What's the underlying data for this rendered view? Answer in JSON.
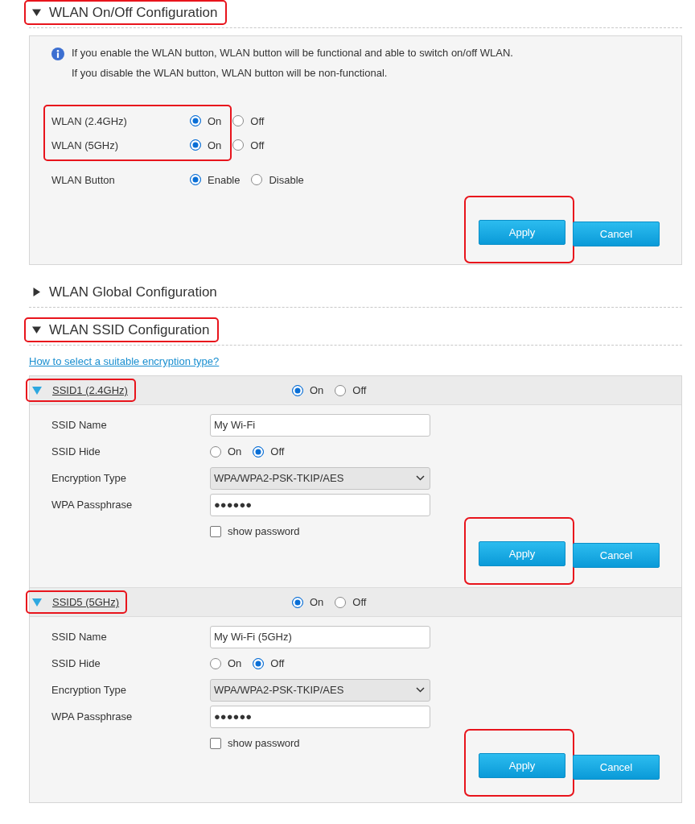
{
  "sections": [
    {
      "kind": "onoff",
      "title": "WLAN On/Off Configuration",
      "expanded": true,
      "highlighted": true,
      "info": [
        "If you enable the WLAN button, WLAN button will be functional and able to switch on/off WLAN.",
        "If you disable the WLAN button, WLAN button will be non-functional."
      ],
      "row_groups": [
        {
          "highlighted": true,
          "rows": [
            {
              "label": "WLAN (2.4GHz)",
              "options": [
                {
                  "label": "On",
                  "selected": true
                },
                {
                  "label": "Off",
                  "selected": false
                }
              ]
            },
            {
              "label": "WLAN (5GHz)",
              "options": [
                {
                  "label": "On",
                  "selected": true
                },
                {
                  "label": "Off",
                  "selected": false
                }
              ]
            }
          ]
        },
        {
          "highlighted": false,
          "rows": [
            {
              "label": "WLAN Button",
              "options": [
                {
                  "label": "Enable",
                  "selected": true
                },
                {
                  "label": "Disable",
                  "selected": false
                }
              ]
            }
          ]
        }
      ],
      "buttons": [
        {
          "label": "Apply",
          "highlighted": true
        },
        {
          "label": "Cancel",
          "highlighted": false
        }
      ]
    },
    {
      "kind": "collapsed",
      "title": "WLAN Global Configuration",
      "expanded": false,
      "highlighted": false
    },
    {
      "kind": "ssid",
      "title": "WLAN SSID Configuration",
      "expanded": true,
      "highlighted": true,
      "link": "How to select a suitable encryption type?",
      "ssids": [
        {
          "name": "SSID1 (2.4GHz)",
          "expanded": true,
          "highlighted": true,
          "options": [
            {
              "label": "On",
              "selected": true
            },
            {
              "label": "Off",
              "selected": false
            }
          ],
          "fields": [
            {
              "kind": "text",
              "label": "SSID Name",
              "value": "My Wi-Fi"
            },
            {
              "kind": "radio",
              "label": "SSID Hide",
              "options": [
                {
                  "label": "On",
                  "selected": false
                },
                {
                  "label": "Off",
                  "selected": true
                }
              ]
            },
            {
              "kind": "select",
              "label": "Encryption Type",
              "value": "WPA/WPA2-PSK-TKIP/AES"
            },
            {
              "kind": "password",
              "label": "WPA Passphrase",
              "value": "●●●●●●"
            },
            {
              "kind": "checkbox",
              "text": "show password",
              "checked": false
            }
          ],
          "buttons": [
            {
              "label": "Apply",
              "highlighted": true
            },
            {
              "label": "Cancel",
              "highlighted": false
            }
          ]
        },
        {
          "name": "SSID5 (5GHz)",
          "expanded": true,
          "highlighted": true,
          "options": [
            {
              "label": "On",
              "selected": true
            },
            {
              "label": "Off",
              "selected": false
            }
          ],
          "fields": [
            {
              "kind": "text",
              "label": "SSID Name",
              "value": "My Wi-Fi (5GHz)"
            },
            {
              "kind": "radio",
              "label": "SSID Hide",
              "options": [
                {
                  "label": "On",
                  "selected": false
                },
                {
                  "label": "Off",
                  "selected": true
                }
              ]
            },
            {
              "kind": "select",
              "label": "Encryption Type",
              "value": "WPA/WPA2-PSK-TKIP/AES"
            },
            {
              "kind": "password",
              "label": "WPA Passphrase",
              "value": "●●●●●●"
            },
            {
              "kind": "checkbox",
              "text": "show password",
              "checked": false
            }
          ],
          "buttons": [
            {
              "label": "Apply",
              "highlighted": true
            },
            {
              "label": "Cancel",
              "highlighted": false
            }
          ]
        }
      ]
    }
  ]
}
